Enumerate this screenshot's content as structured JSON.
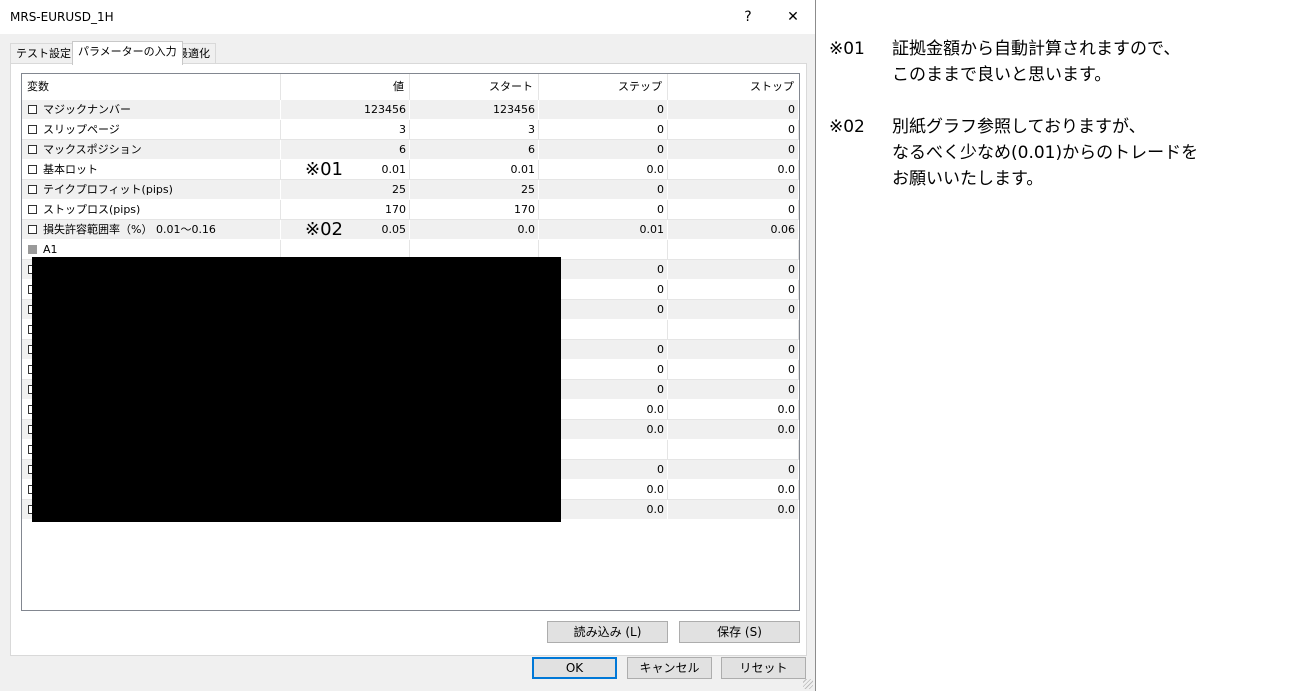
{
  "window": {
    "title": "MRS-EURUSD_1H",
    "help_glyph": "?",
    "close_glyph": "✕"
  },
  "tabs": [
    {
      "label": "テスト設定",
      "active": false
    },
    {
      "label": "パラメーターの入力",
      "active": true
    },
    {
      "label": "最適化",
      "active": false
    }
  ],
  "table": {
    "headers": [
      "変数",
      "値",
      "スタート",
      "ステップ",
      "ストップ"
    ],
    "rows": [
      {
        "name": "マジックナンバー",
        "value": "123456",
        "start": "123456",
        "step": "0",
        "stop": "0"
      },
      {
        "name": "スリップページ",
        "value": "3",
        "start": "3",
        "step": "0",
        "stop": "0"
      },
      {
        "name": "マックスポジション",
        "value": "6",
        "start": "6",
        "step": "0",
        "stop": "0"
      },
      {
        "name": "基本ロット",
        "value": "0.01",
        "start": "0.01",
        "step": "0.0",
        "stop": "0.0",
        "mark": "※01"
      },
      {
        "name": "テイクプロフィット(pips)",
        "value": "25",
        "start": "25",
        "step": "0",
        "stop": "0"
      },
      {
        "name": "ストップロス(pips)",
        "value": "170",
        "start": "170",
        "step": "0",
        "stop": "0"
      },
      {
        "name": "損失許容範囲率（%） 0.01〜0.16",
        "value": "0.05",
        "start": "0.0",
        "step": "0.01",
        "stop": "0.06",
        "mark": "※02"
      },
      {
        "name": "A1",
        "value": "",
        "start": "",
        "step": "",
        "stop": "",
        "group": true
      },
      {
        "name": "",
        "value": "",
        "start": "",
        "step": "0",
        "stop": "0"
      },
      {
        "name": "",
        "value": "",
        "start": "",
        "step": "0",
        "stop": "0"
      },
      {
        "name": "",
        "value": "",
        "start": "",
        "step": "0",
        "stop": "0"
      },
      {
        "name": "",
        "value": "",
        "start": "",
        "step": "",
        "stop": ""
      },
      {
        "name": "",
        "value": "",
        "start": "",
        "step": "0",
        "stop": "0"
      },
      {
        "name": "",
        "value": "",
        "start": "",
        "step": "0",
        "stop": "0"
      },
      {
        "name": "",
        "value": "",
        "start": "",
        "step": "0",
        "stop": "0"
      },
      {
        "name": "",
        "value": "",
        "start": "",
        "step": "0.0",
        "stop": "0.0"
      },
      {
        "name": "",
        "value": "",
        "start": "",
        "step": "0.0",
        "stop": "0.0"
      },
      {
        "name": "",
        "value": "",
        "start": "",
        "step": "",
        "stop": ""
      },
      {
        "name": "",
        "value": "",
        "start": "",
        "step": "0",
        "stop": "0"
      },
      {
        "name": "",
        "value": "",
        "start": "",
        "step": "0.0",
        "stop": "0.0"
      },
      {
        "name": "",
        "value": "",
        "start": "",
        "step": "0.0",
        "stop": "0.0"
      }
    ]
  },
  "buttons": {
    "load": "読み込み (L)",
    "save": "保存 (S)",
    "ok": "OK",
    "cancel": "キャンセル",
    "reset": "リセット"
  },
  "notes": [
    {
      "label": "※01",
      "lines": [
        "証拠金額から自動計算されますので、",
        "このままで良いと思います。"
      ]
    },
    {
      "label": "※02",
      "lines": [
        "別紙グラフ参照しておりますが、",
        "なるべく少なめ(0.01)からのトレードを",
        "お願いいたします。"
      ]
    }
  ]
}
